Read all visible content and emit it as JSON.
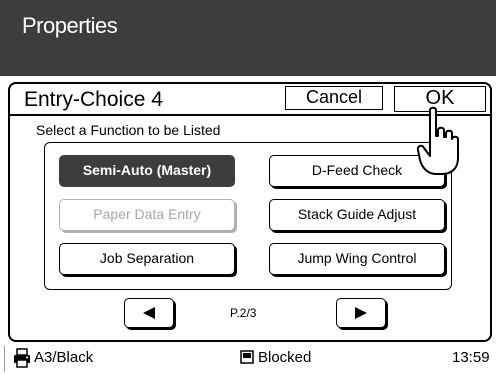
{
  "header": {
    "title": "Properties"
  },
  "dialog": {
    "title": "Entry-Choice 4",
    "cancel_label": "Cancel",
    "ok_label": "OK",
    "subtitle": "Select a Function to be Listed"
  },
  "functions": [
    {
      "label": "Semi-Auto (Master)",
      "state": "selected"
    },
    {
      "label": "D-Feed Check",
      "state": "normal"
    },
    {
      "label": "Paper Data Entry",
      "state": "disabled"
    },
    {
      "label": "Stack Guide Adjust",
      "state": "normal"
    },
    {
      "label": "Job Separation",
      "state": "normal"
    },
    {
      "label": "Jump Wing Control",
      "state": "normal"
    }
  ],
  "pagination": {
    "indicator": "P.2/3",
    "prev_icon": "left-triangle-icon",
    "next_icon": "right-triangle-icon"
  },
  "status": {
    "paper": "A3/Black",
    "paper_icon": "printer-icon",
    "state": "Blocked",
    "state_icon": "blocked-icon",
    "time": "13:59"
  },
  "colors": {
    "header_bg": "#3d3d3d",
    "selected_bg": "#3d3d3d",
    "disabled_text": "#a8a8a8"
  }
}
